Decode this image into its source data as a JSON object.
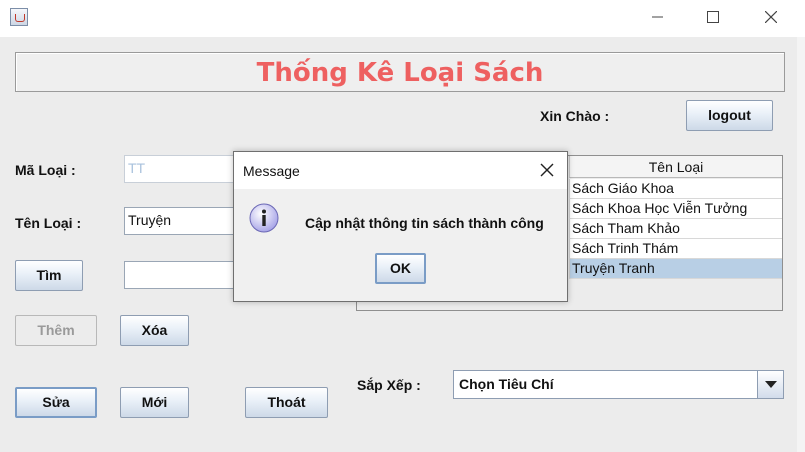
{
  "window": {
    "title": "",
    "minimize_icon": "minimize-icon",
    "maximize_icon": "maximize-icon",
    "close_icon": "close-icon"
  },
  "header": {
    "title": "Thống Kê Loại Sách",
    "title_color": "#ee6060"
  },
  "greeting": {
    "label": "Xin Chào :",
    "logout": "logout"
  },
  "form": {
    "ma_loai_label": "Mã Loại :",
    "ma_loai_value": "TT",
    "ten_loai_label": "Tên Loại :",
    "ten_loai_value": "Truyện",
    "search_value": ""
  },
  "buttons": {
    "tim": "Tìm",
    "them": "Thêm",
    "xoa": "Xóa",
    "sua": "Sửa",
    "moi": "Mới",
    "thoat": "Thoát"
  },
  "table": {
    "header": "Tên Loại",
    "rows": [
      "Sách Giáo Khoa",
      "Sách Khoa Học Viễn Tưởng",
      "Sách Tham Khảo",
      "Sách Trinh Thám",
      "Truyện Tranh"
    ],
    "selected_index": 4
  },
  "sort": {
    "label": "Sắp Xếp :",
    "selected": "Chọn Tiêu Chí"
  },
  "dialog": {
    "title": "Message",
    "message": "Cập nhật thông tin sách thành công",
    "ok": "OK",
    "icon": "info-icon"
  }
}
